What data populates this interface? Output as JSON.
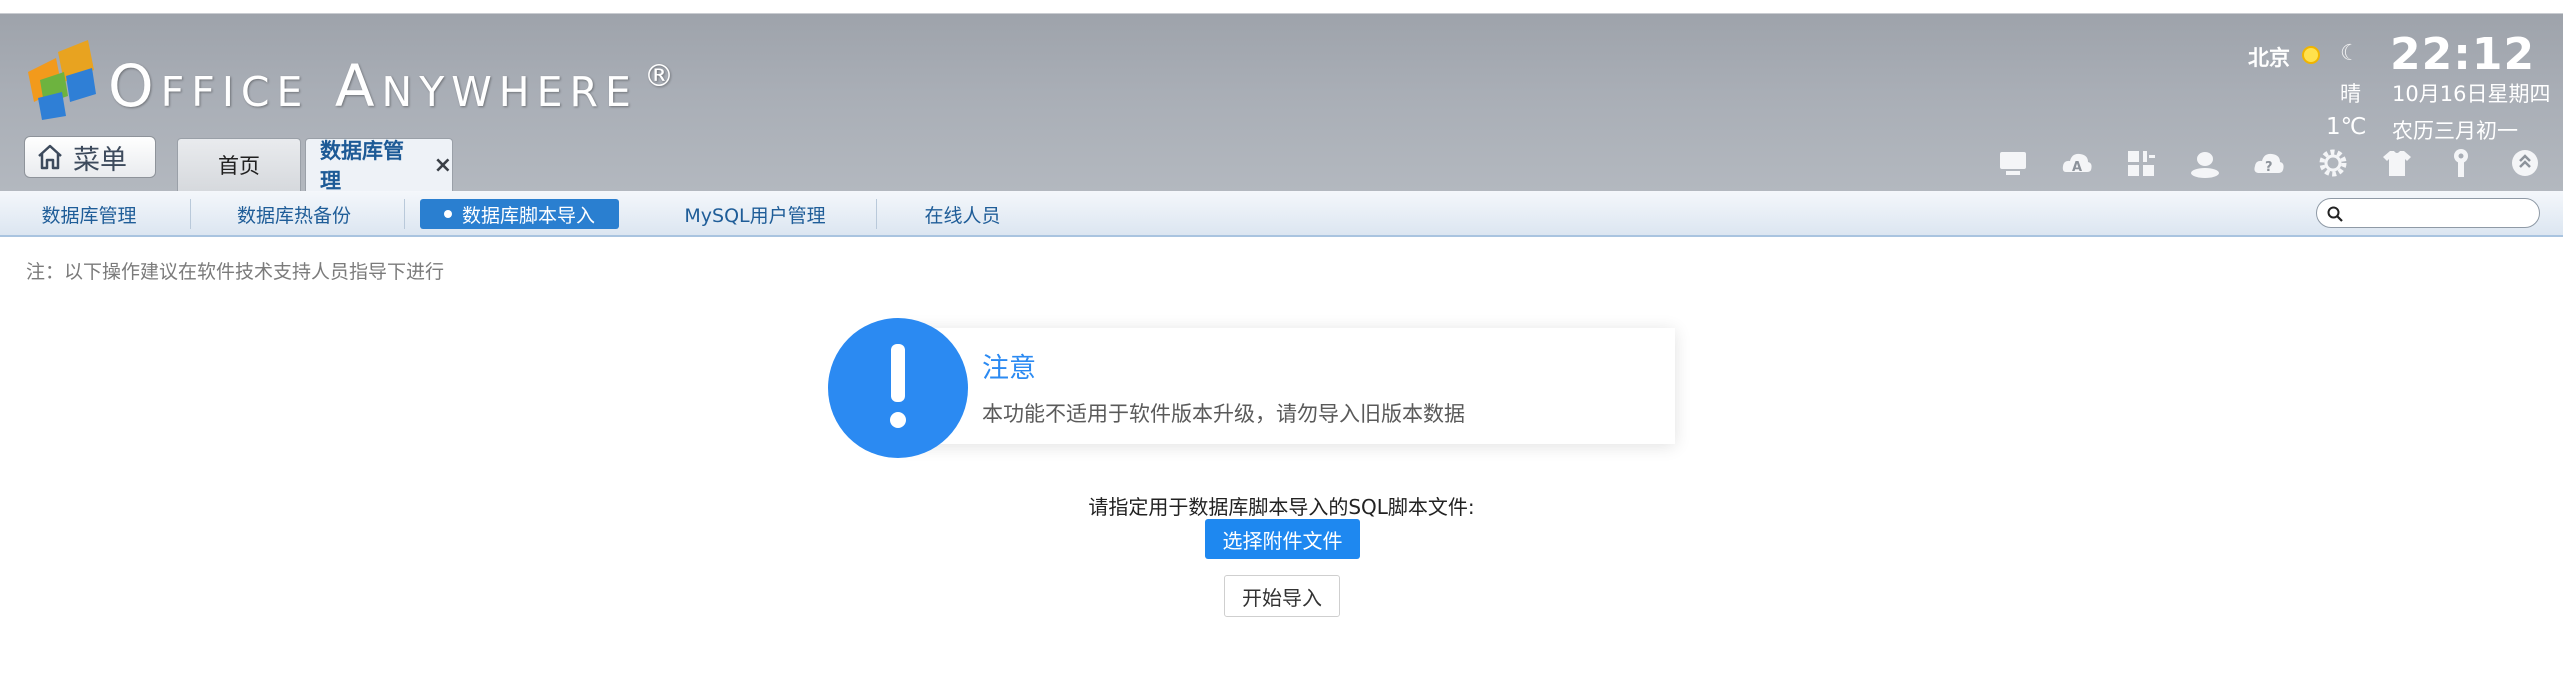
{
  "header": {
    "brand": "Office Anywhere",
    "brand_reg": "®",
    "city": "北京",
    "clock": "22:12",
    "weather": "晴",
    "date": "10月16日星期四",
    "temperature": "1℃",
    "lunar_date": "农历三月初一"
  },
  "menu": {
    "label": "菜单",
    "icon": "home-icon"
  },
  "tabs": [
    {
      "label": "首页"
    },
    {
      "label": "数据库管理",
      "close": "×",
      "active": true
    }
  ],
  "toolbar_icons": [
    "monitor-icon",
    "cloud-a-icon",
    "modules-icon",
    "user-icon",
    "cloud-help-icon",
    "settings-icon",
    "shirt-icon",
    "key-icon",
    "logout-icon"
  ],
  "subnav": {
    "items": [
      {
        "label": "数据库管理"
      },
      {
        "label": "数据库热备份"
      },
      {
        "label": "数据库脚本导入",
        "active": true
      },
      {
        "label": "MySQL用户管理"
      },
      {
        "label": "在线人员"
      }
    ],
    "search_placeholder": ""
  },
  "content": {
    "note": "注：以下操作建议在软件技术支持人员指导下进行",
    "notice_title": "注意",
    "notice_message": "本功能不适用于软件版本升级，请勿导入旧版本数据",
    "prompt": "请指定用于数据库脚本导入的SQL脚本文件:",
    "select_file_label": "选择附件文件",
    "start_import_label": "开始导入"
  },
  "colors": {
    "header_bg": "#a9aeb6",
    "accent": "#2b8af2",
    "active_subnav": "#2a7fd0",
    "subnav_text": "#1f5d98"
  }
}
